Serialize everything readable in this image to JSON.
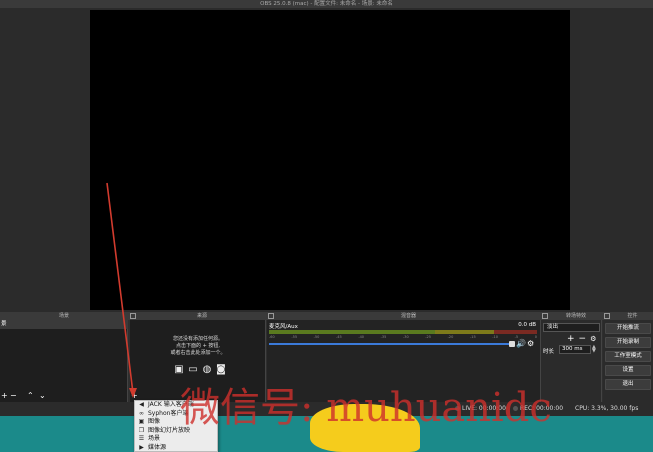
{
  "window": {
    "title": "OBS 25.0.8 (mac) - 配置文件: 未命名 - 场景: 未命名"
  },
  "docks": {
    "scenes_title": "场景",
    "sources_title": "来源",
    "mixer_title": "混音器",
    "transitions_title": "转场特效",
    "controls_title": "控件"
  },
  "scenes": {
    "items": [
      {
        "label": "景"
      }
    ]
  },
  "sources": {
    "empty_line1": "您还没有添加任何源。",
    "empty_line2": "点击下面的 + 按钮,",
    "empty_line3": "或者右击此处添加一个。",
    "icons": [
      "image-icon",
      "monitor-icon",
      "globe-icon",
      "camera-icon"
    ]
  },
  "mixer": {
    "track_name": "麦克风/Aux",
    "level": "0.0 dB",
    "ticks": [
      "-60",
      "-55",
      "-50",
      "-45",
      "-40",
      "-35",
      "-30",
      "-25",
      "-20",
      "-15",
      "-10",
      "-5",
      "0"
    ],
    "volume": 0.92,
    "colors": {
      "green": "#5a7a1f",
      "yellow": "#7d7a1a",
      "red": "#7a2a22",
      "slider": "#3b7ad9"
    }
  },
  "transitions": {
    "selected": "淡出",
    "duration_label": "时长",
    "duration_value": "300 ms"
  },
  "controls": {
    "buttons": [
      "开始推流",
      "开始录制",
      "工作室模式",
      "设置",
      "退出"
    ]
  },
  "status": {
    "live": "LIVE: 00:00:00",
    "rec": "REC: 00:00:00",
    "cpu": "CPU: 3.3%, 30.00 fps"
  },
  "add_source_menu": {
    "items": [
      {
        "icon": "speaker-icon",
        "label": "JACK 输入客户端"
      },
      {
        "icon": "link-icon",
        "label": "Syphon客户端"
      },
      {
        "icon": "image-icon",
        "label": "图像"
      },
      {
        "icon": "slideshow-icon",
        "label": "图像幻灯片放映"
      },
      {
        "icon": "list-icon",
        "label": "场景"
      },
      {
        "icon": "play-icon",
        "label": "媒体源"
      }
    ]
  },
  "watermark": {
    "text": "微信号: muhuanidc"
  }
}
